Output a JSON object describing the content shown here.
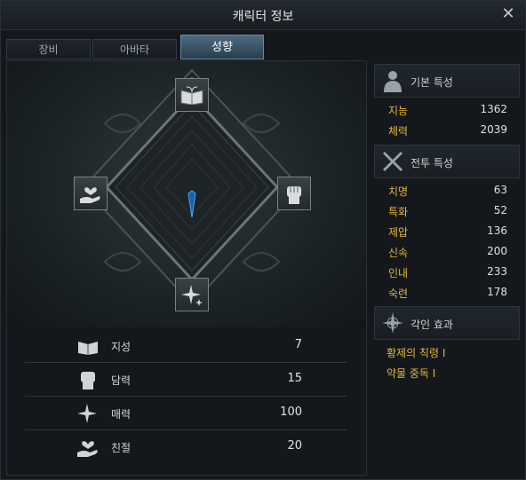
{
  "window": {
    "title": "캐릭터 정보",
    "close": "✕"
  },
  "tabs": [
    {
      "label": "장비"
    },
    {
      "label": "아바타"
    },
    {
      "label": "성향"
    }
  ],
  "traits": [
    {
      "name": "지성",
      "value": "7",
      "icon": "book-icon"
    },
    {
      "name": "담력",
      "value": "15",
      "icon": "fist-icon"
    },
    {
      "name": "매력",
      "value": "100",
      "icon": "sparkle-icon"
    },
    {
      "name": "친절",
      "value": "20",
      "icon": "heart-hand-icon"
    }
  ],
  "basic_stats": {
    "title": "기본 특성",
    "icon": "person-icon",
    "items": [
      {
        "name": "지능",
        "value": "1362"
      },
      {
        "name": "체력",
        "value": "2039"
      }
    ]
  },
  "combat_stats": {
    "title": "전투 특성",
    "icon": "crossed-swords-icon",
    "items": [
      {
        "name": "치명",
        "value": "63"
      },
      {
        "name": "특화",
        "value": "52"
      },
      {
        "name": "제압",
        "value": "136"
      },
      {
        "name": "신속",
        "value": "200"
      },
      {
        "name": "인내",
        "value": "233"
      },
      {
        "name": "숙련",
        "value": "178"
      }
    ]
  },
  "engravings": {
    "title": "각인 효과",
    "icon": "compass-rose-icon",
    "items": [
      {
        "name": "황제의 칙령 I"
      },
      {
        "name": "약물 중독 I"
      }
    ]
  },
  "colors": {
    "accent": "#e3b53a",
    "tab_active": "#3d5a6e",
    "indicator": "#2f7fd8"
  }
}
